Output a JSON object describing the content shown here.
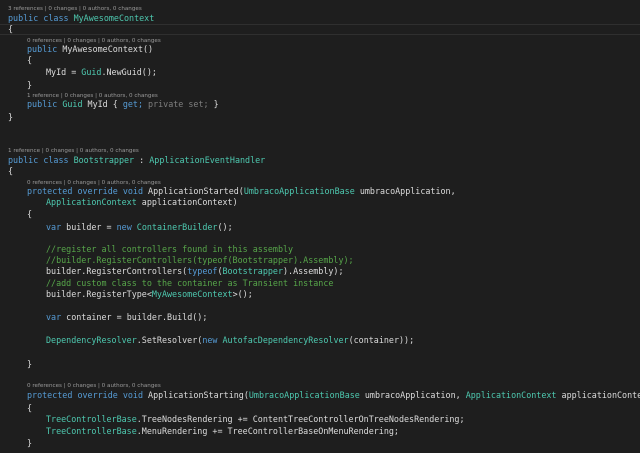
{
  "lenses": {
    "l1": "3 references | 0 changes | 0 authors, 0 changes",
    "l2": "0 references | 0 changes | 0 authors, 0 changes",
    "l3": "1 reference | 0 changes | 0 authors, 0 changes",
    "l4": "1 reference | 0 changes | 0 authors, 0 changes",
    "l5": "0 references | 0 changes | 0 authors, 0 changes",
    "l6": "0 references | 0 changes | 0 authors, 0 changes"
  },
  "code": {
    "public": "public",
    "class": "class",
    "MyAwesomeContext": "MyAwesomeContext",
    "open_brace": "{",
    "close_brace": "}",
    "ctor_sig": "MyAwesomeContext()",
    "myid_assign": "MyId = ",
    "Guid": "Guid",
    "newguid_call": ".NewGuid();",
    "myid_prop": " MyId { ",
    "get": "get;",
    "private": "private",
    "set": "set;",
    "prop_close": " }",
    "Bootstrapper": "Bootstrapper",
    "colon": " : ",
    "ApplicationEventHandler": "ApplicationEventHandler",
    "protected": "protected",
    "override": "override",
    "void": "void",
    "started_name": " ApplicationStarted(",
    "UmbracoApplicationBase": "UmbracoApplicationBase",
    "umbraco_param_comma": " umbracoApplication,",
    "ApplicationContext": "ApplicationContext",
    "appctx_param_close": " applicationContext)",
    "var": "var",
    "builder_eq": " builder = ",
    "new": "new",
    "ContainerBuilder": "ContainerBuilder",
    "call_end": "();",
    "comment1": "//register all controllers found in this assembly",
    "comment2": "//builder.RegisterControllers(typeof(Bootstrapper).Assembly);",
    "register_controllers": "builder.RegisterControllers(",
    "typeof": "typeof",
    "paren_open": "(",
    "assembly_end": ").Assembly);",
    "comment3": "//add custom class to the container as Transient instance",
    "register_type": "builder.RegisterType<",
    "generic_end": ">();",
    "container_eq": " container = builder.Build();",
    "DependencyResolver": "DependencyResolver",
    "set_resolver": ".SetResolver(",
    "AutofacDependencyResolver": "AutofacDependencyResolver",
    "container_arg_end": "(container));",
    "starting_name": " ApplicationStarting(",
    "umbraco_param_comma_space": " umbracoApplication, ",
    "TreeControllerBase": "TreeControllerBase",
    "tree_nodes_rendering": ".TreeNodesRendering += ContentTreeControllerOnTreeNodesRendering;",
    "menu_rendering": ".MenuRendering += TreeControllerBaseOnMenuRendering;"
  }
}
